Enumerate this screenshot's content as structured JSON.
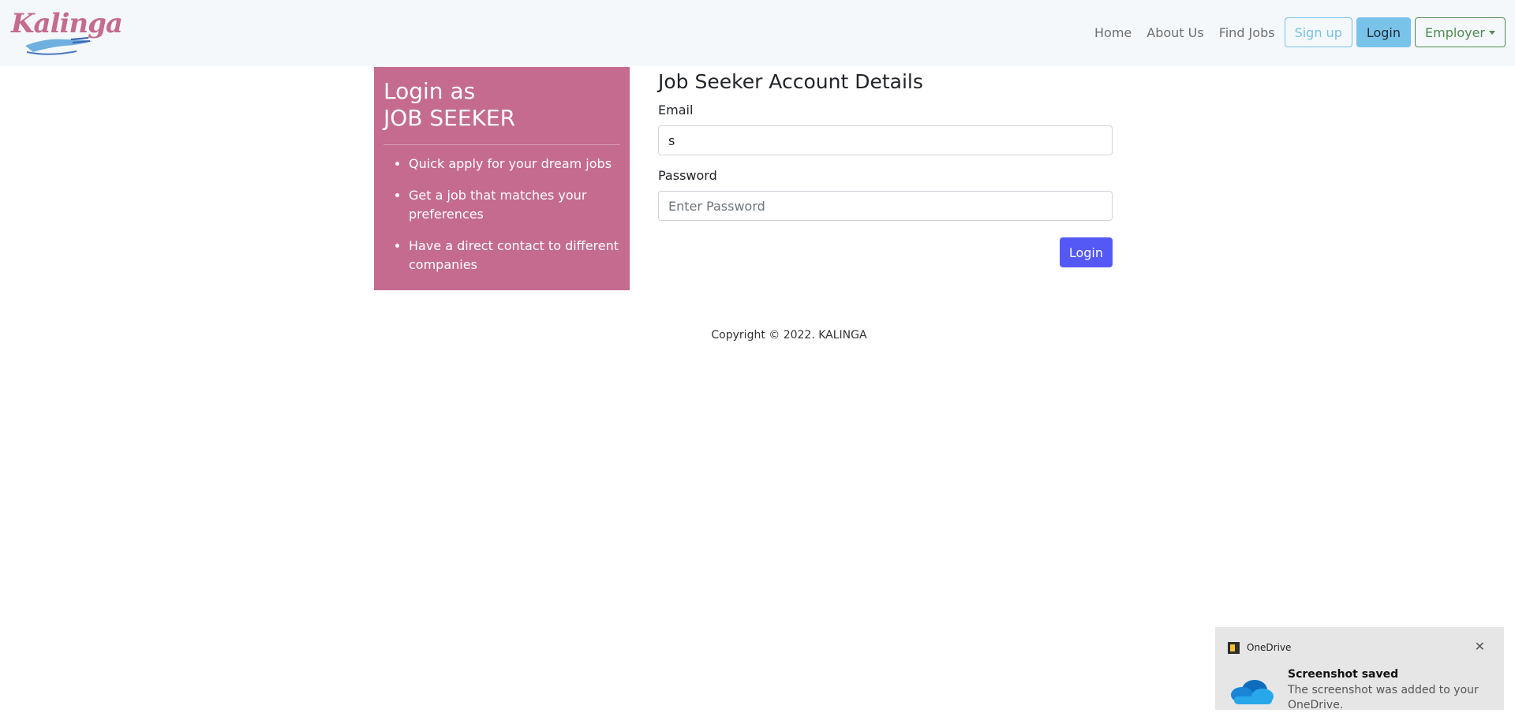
{
  "brand": {
    "name": "Kalinga",
    "pink": "#c46b8f",
    "blue": "#6fb0e0"
  },
  "nav": {
    "links": [
      "Home",
      "About Us",
      "Find Jobs"
    ],
    "signup_label": "Sign up",
    "login_label": "Login",
    "employer_label": "Employer"
  },
  "side": {
    "title_line1": "Login as",
    "title_line2": "JOB SEEKER",
    "items": [
      "Quick apply for your dream jobs",
      "Get a job that matches your preferences",
      "Have a direct contact to different companies"
    ]
  },
  "form": {
    "title": "Job Seeker Account Details",
    "email_label": "Email",
    "email_value": "s",
    "password_label": "Password",
    "password_placeholder": "Enter Password",
    "submit_label": "Login"
  },
  "footer": {
    "text": "Copyright © 2022. KALINGA"
  },
  "toast": {
    "app": "OneDrive",
    "title": "Screenshot saved",
    "body": "The screenshot was added to your OneDrive.",
    "close": "✕"
  }
}
